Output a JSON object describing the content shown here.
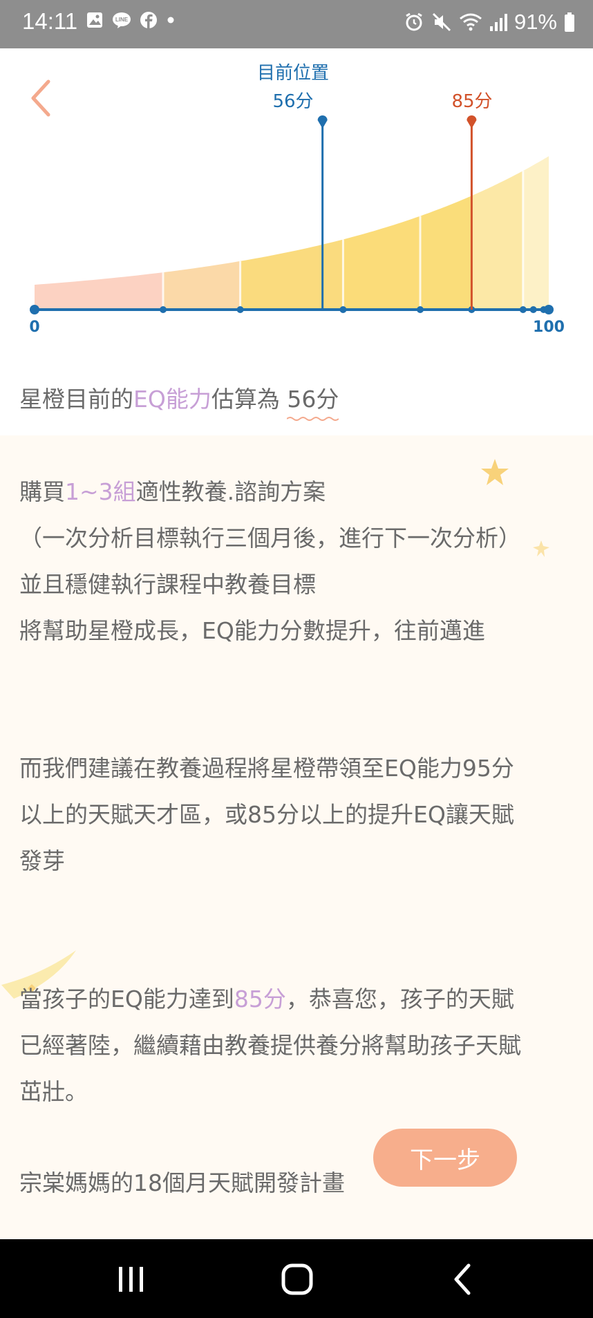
{
  "status_bar": {
    "time": "14:11",
    "battery": "91%",
    "icons": [
      "image-icon",
      "line-icon",
      "facebook-icon",
      "dot-icon",
      "alarm-icon",
      "mute-icon",
      "wifi-icon",
      "signal-icon",
      "battery-icon"
    ]
  },
  "header": {
    "back_icon": "chevron-left-icon"
  },
  "chart": {
    "current_label": "目前位置",
    "current_score_label": "56分",
    "target_score_label": "85分",
    "axis_min_label": "0",
    "axis_max_label": "100",
    "colors": {
      "current": "#1f6fae",
      "target": "#d2522a",
      "axis": "#1f6fae"
    }
  },
  "chart_data": {
    "type": "area",
    "x_range": [
      0,
      100
    ],
    "markers": [
      {
        "label": "目前位置",
        "value": 56
      },
      {
        "label": "85分",
        "value": 85
      }
    ],
    "segments": [
      {
        "from": 0,
        "to": 25,
        "color": "#fcd2c2"
      },
      {
        "from": 25,
        "to": 40,
        "color": "#fbd9a8"
      },
      {
        "from": 40,
        "to": 60,
        "color": "#fadb7e"
      },
      {
        "from": 60,
        "to": 75,
        "color": "#fbdc79"
      },
      {
        "from": 75,
        "to": 85,
        "color": "#fadd7a"
      },
      {
        "from": 85,
        "to": 95,
        "color": "#fce8a6"
      },
      {
        "from": 95,
        "to": 100,
        "color": "#fdf1c7"
      }
    ],
    "axis_dots": [
      0,
      25,
      40,
      60,
      75,
      85,
      95,
      97,
      99,
      100
    ],
    "xlabel": "",
    "ylabel": ""
  },
  "content": {
    "line1_pre": "星橙目前的",
    "line1_hl": "EQ能力",
    "line1_mid": "估算為 ",
    "line1_score": "56分",
    "p2_l1_pre": "購買",
    "p2_l1_hl": "1~3組",
    "p2_l1_post": "適性教養.諮詢方案",
    "p2_l2": "（一次分析目標執行三個月後，進行下一次分析）",
    "p2_l3": "並且穩健執行課程中教養目標",
    "p2_l4": "將幫助星橙成長，EQ能力分數提升，往前邁進",
    "p3_l1": "而我們建議在教養過程將星橙帶領至EQ能力95分",
    "p3_l2": "以上的天賦天才區，或85分以上的提升EQ讓天賦",
    "p3_l3": "發芽",
    "p4_l1_pre": "當孩子的EQ能力達到",
    "p4_l1_hl": "85分",
    "p4_l1_post": "，恭喜您，孩子的天賦",
    "p4_l2": "已經著陸，繼續藉由教養提供養分將幫助孩子天賦",
    "p4_l3": "茁壯。",
    "p5_l1": "宗棠媽媽的18個月天賦開發計畫"
  },
  "actions": {
    "next_label": "下一步"
  },
  "nav": {
    "items": [
      "recent-apps-icon",
      "home-icon",
      "back-icon"
    ]
  }
}
